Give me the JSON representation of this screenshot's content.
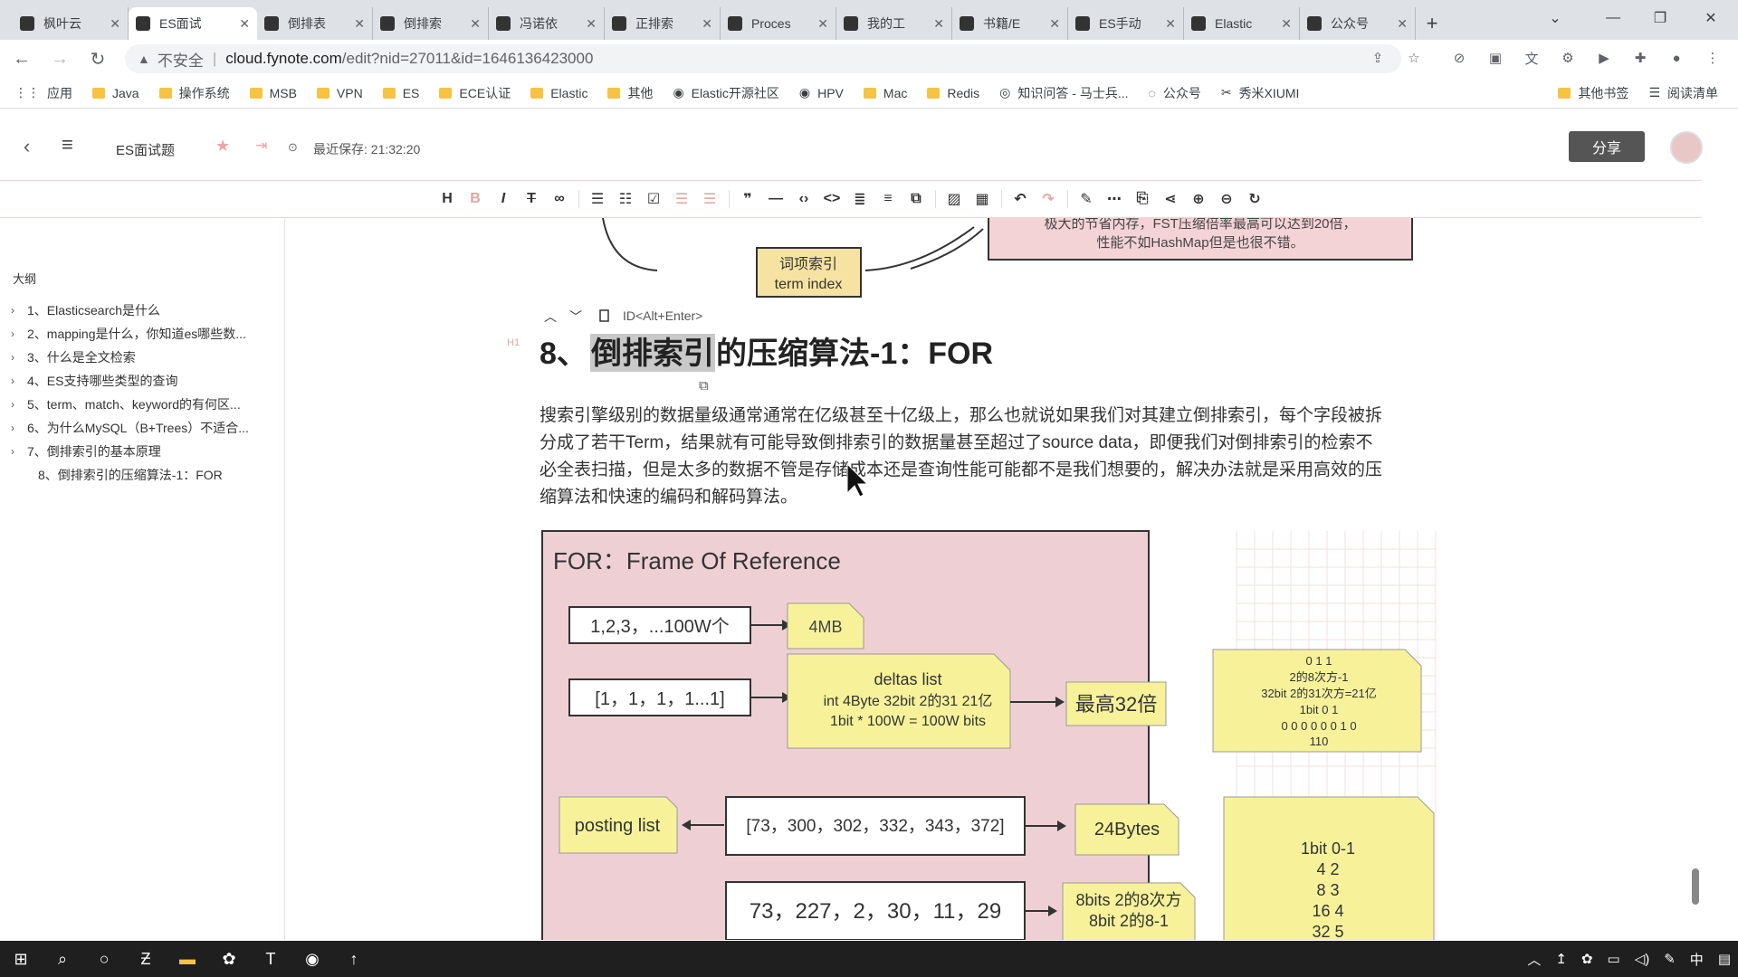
{
  "browser": {
    "tabs": [
      {
        "label": "枫叶云",
        "icon": "notebook-icon"
      },
      {
        "label": "ES面试",
        "icon": "notebook-icon"
      },
      {
        "label": "倒排表",
        "icon": "notebook-icon"
      },
      {
        "label": "倒排索",
        "icon": "on-icon"
      },
      {
        "label": "冯诺依",
        "icon": "paw-icon"
      },
      {
        "label": "正排索",
        "icon": "notebook-icon"
      },
      {
        "label": "Proces",
        "icon": "on-icon"
      },
      {
        "label": "我的工",
        "icon": "bilibili-icon"
      },
      {
        "label": "书籍/E",
        "icon": "bilibili-icon"
      },
      {
        "label": "ES手动",
        "icon": "globe-icon"
      },
      {
        "label": "Elastic",
        "icon": "elastic-icon"
      },
      {
        "label": "公众号",
        "icon": "wechat-icon"
      }
    ],
    "address": {
      "insecure": "不安全",
      "host": "cloud.fynote.com",
      "path": "/edit?nid=27011&id=1646136423000"
    },
    "bookmarks": [
      "应用",
      "Java",
      "操作系统",
      "MSB",
      "VPN",
      "ES",
      "ECE认证",
      "Elastic",
      "其他",
      "Elastic开源社区",
      "HPV",
      "Mac",
      "Redis",
      "知识问答 - 马士兵...",
      "公众号",
      "秀米XIUMI"
    ],
    "bookmarks_right": [
      "其他书签",
      "阅读清单"
    ]
  },
  "app": {
    "doc_title": "ES面试题",
    "saved": "最近保存: 21:32:20",
    "share": "分享"
  },
  "outline": {
    "title": "大纲",
    "items": [
      "1、Elasticsearch是什么",
      "2、mapping是什么，你知道es哪些数...",
      "3、什么是全文检索",
      "4、ES支持哪些类型的查询",
      "5、term、match、keyword的有何区...",
      "6、为什么MySQL（B+Trees）不适合...",
      "7、倒排索引的基本原理",
      "8、倒排索引的压缩算法-1：FOR"
    ]
  },
  "editor": {
    "top_diagram": {
      "text1": "极大的节省内存，FST压缩倍率最高可以达到20倍，",
      "text2": "性能不如HashMap但是也很不错。",
      "box_l1": "词项索引",
      "box_l2": "term index"
    },
    "block_hint": "ID<Alt+Enter>",
    "h1_marker": "H1",
    "heading_prefix": "8、",
    "heading_highlight": "倒排索引",
    "heading_rest": "的压缩算法-1：FOR",
    "paragraph": [
      "搜索引擎级别的数据量级通常通常在亿级甚至十亿级上，那么也就说如果我们对其建立倒排索引，每个字段被拆",
      "分成了若干Term，结果就有可能导致倒排索引的数据量甚至超过了source data，即便我们对倒排索引的检索不",
      "必全表扫描，但是太多的数据不管是存储成本还是查询性能可能都不是我们想要的，解决办法就是采用高效的压",
      "缩算法和快速的编码和解码算法。"
    ],
    "figure": {
      "title": "FOR：Frame Of Reference",
      "b1": "1,2,3，...100W个",
      "n1": "4MB",
      "b2": "[1，1，1，1...1]",
      "n2_l1": "deltas list",
      "n2_l2": "int 4Byte 32bit  2的31 21亿",
      "n2_l3": "1bit * 100W = 100W bits",
      "n3": "最高32倍",
      "posting": "posting list",
      "b3": "[73，300，302，332，343，372]",
      "n4": "24Bytes",
      "b4": "73，227，2，30，11，29",
      "n5_l1": "8bits 2的8次方",
      "n5_l2": "8bit  2的8-1",
      "side1": [
        "0 1 1",
        "2的8次方-1",
        "32bit 2的31次方=21亿",
        "1bit 0 1",
        "0 0 0 0 0 0 1 0",
        "110"
      ],
      "side2": [
        "1bit  0-1",
        "4 2",
        "8 3",
        "16 4",
        "32 5"
      ]
    }
  },
  "taskbar": {
    "tray": [
      "中"
    ]
  }
}
